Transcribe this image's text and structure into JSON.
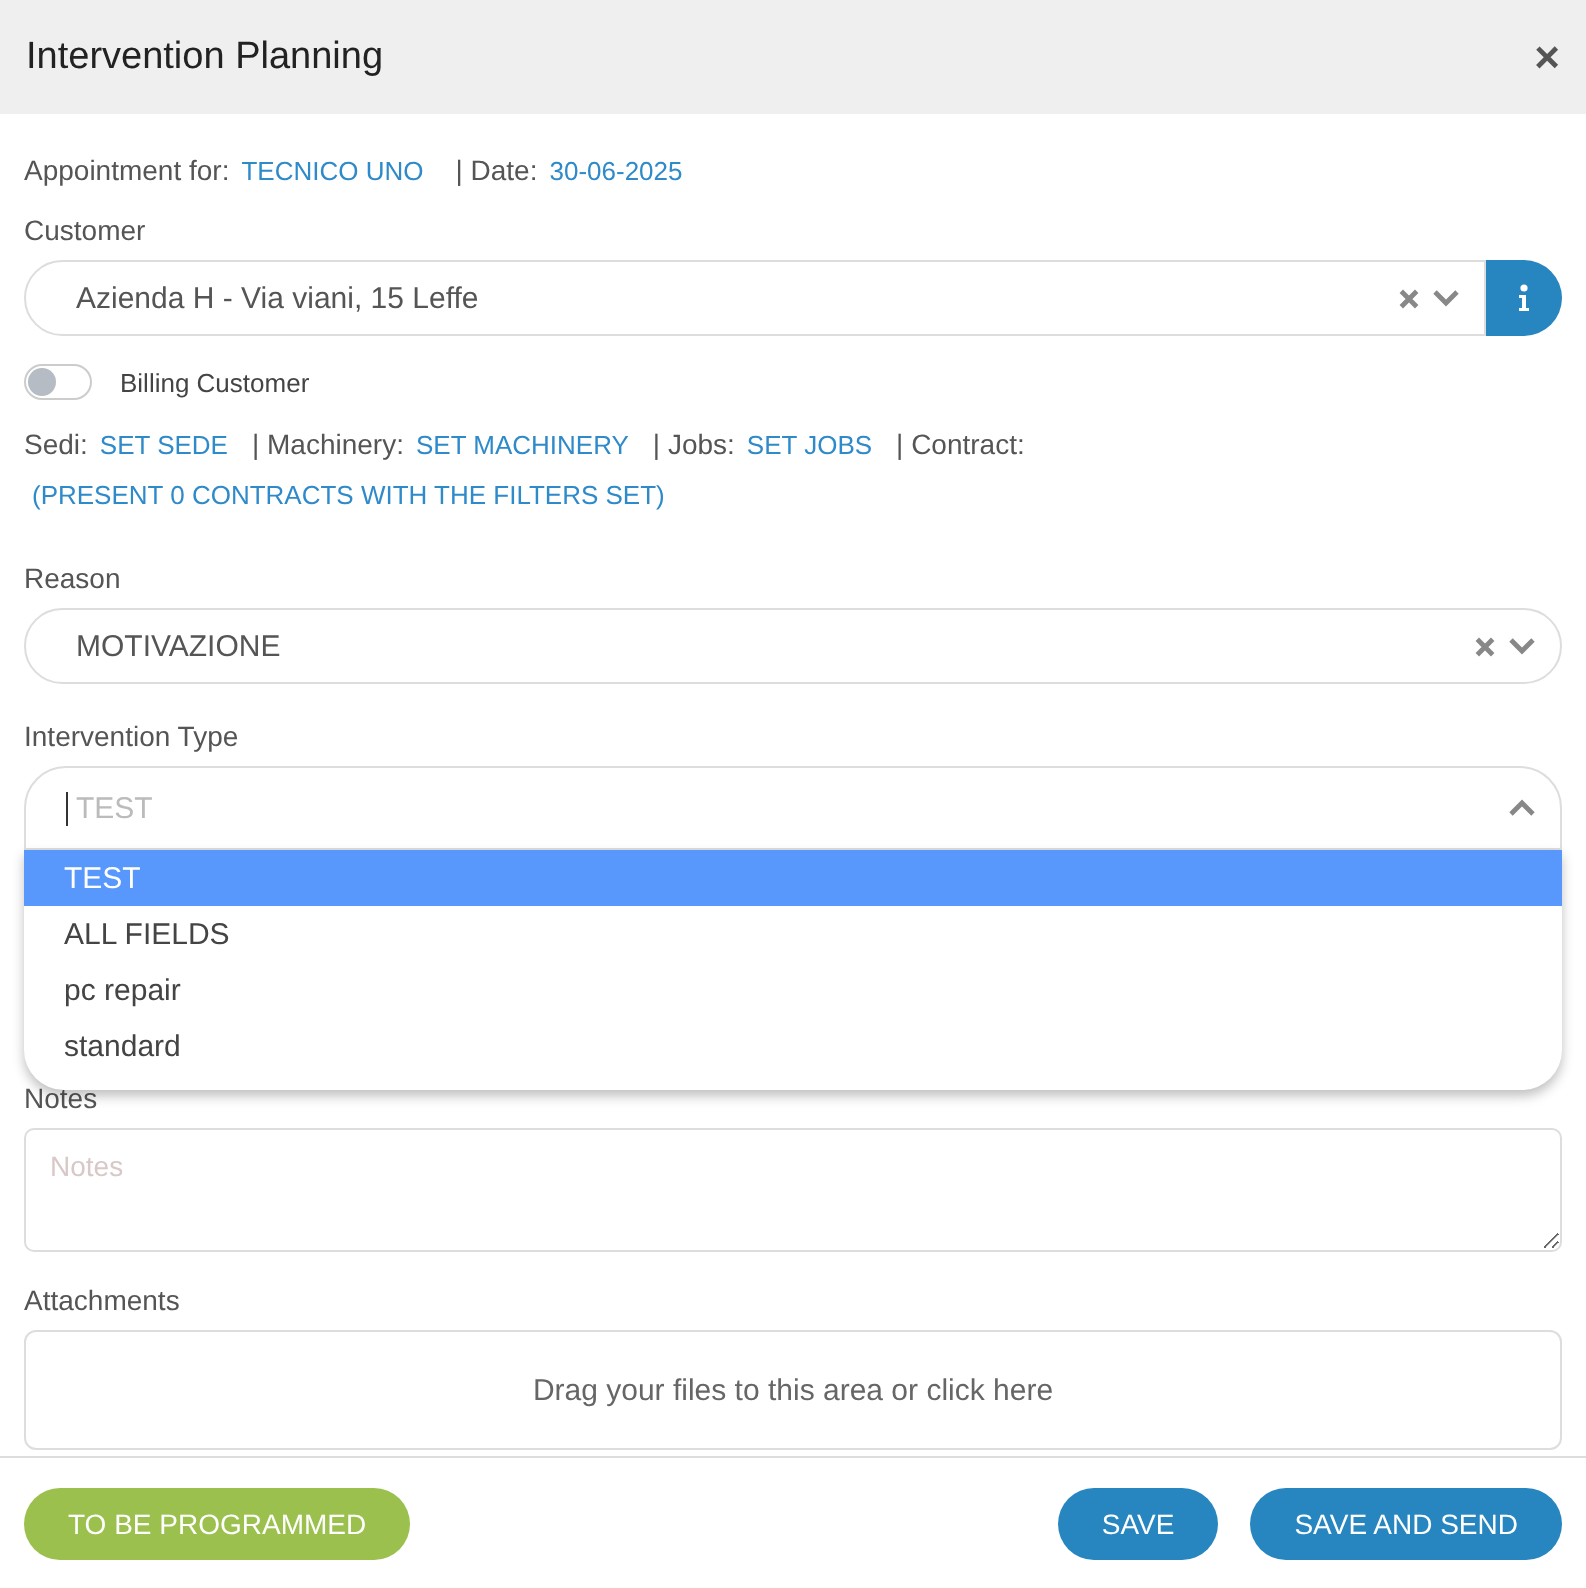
{
  "window": {
    "title": "Intervention Planning",
    "close": "×"
  },
  "appointment": {
    "label": "Appointment for:",
    "technician": "TECNICO UNO",
    "date_label": "| Date:",
    "date": "30-06-2025"
  },
  "customer": {
    "label": "Customer",
    "value": "Azienda H - Via viani, 15 Leffe"
  },
  "billing_customer": {
    "label": "Billing Customer",
    "on": false
  },
  "links": [
    {
      "label": "Sedi:",
      "link": "SET SEDE"
    },
    {
      "label": "| Machinery:",
      "link": "SET MACHINERY"
    },
    {
      "label": "| Jobs:",
      "link": "SET JOBS"
    },
    {
      "label": "| Contract:"
    }
  ],
  "contracts_note": "(PRESENT 0 CONTRACTS WITH THE FILTERS SET)",
  "reason": {
    "label": "Reason",
    "value": "MOTIVAZIONE"
  },
  "intervention_type": {
    "label": "Intervention Type",
    "placeholder": "TEST",
    "expanded": true,
    "options": [
      {
        "label": "TEST",
        "selected": true
      },
      {
        "label": "ALL FIELDS",
        "selected": false
      },
      {
        "label": "pc repair",
        "selected": false
      },
      {
        "label": "standard",
        "selected": false
      }
    ]
  },
  "notes": {
    "label": "Notes",
    "placeholder": "Notes"
  },
  "attachments": {
    "label": "Attachments",
    "hint": "Drag your files to this area or click here"
  },
  "buttons": [
    {
      "label": "TO BE PROGRAMMED",
      "kind": "status"
    },
    {
      "label": "SAVE",
      "kind": "primary"
    },
    {
      "label": "SAVE AND SEND",
      "kind": "primary"
    }
  ]
}
